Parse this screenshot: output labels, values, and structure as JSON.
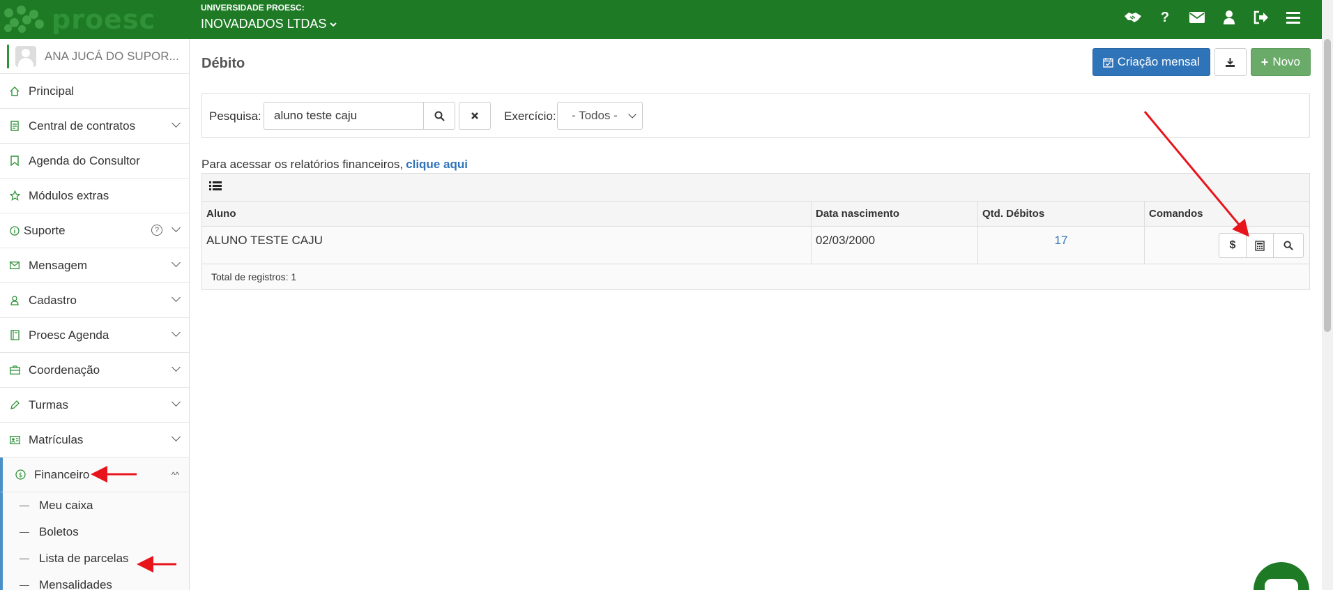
{
  "header": {
    "org_small": "UNIVERSIDADE PROESC:",
    "org_name": "INOVADADOS LTDAS",
    "logo_text": "proesc",
    "icons": [
      "handshake-icon",
      "question-icon",
      "envelope-icon",
      "user-icon",
      "sign-out-icon",
      "menu-icon"
    ]
  },
  "sidebar": {
    "user_name": "ANA JUCÁ DO SUPOR...",
    "items": [
      {
        "label": "Principal",
        "icon": "home-icon"
      },
      {
        "label": "Central de contratos",
        "icon": "document-icon"
      },
      {
        "label": "Agenda do Consultor",
        "icon": "bookmark-icon"
      },
      {
        "label": "Módulos extras",
        "icon": "star-icon"
      },
      {
        "label": "Suporte",
        "icon": "info-icon"
      },
      {
        "label": "Mensagem",
        "icon": "envelope-icon"
      },
      {
        "label": "Cadastro",
        "icon": "user-icon"
      },
      {
        "label": "Proesc Agenda",
        "icon": "book-icon"
      },
      {
        "label": "Coordenação",
        "icon": "briefcase-icon"
      },
      {
        "label": "Turmas",
        "icon": "pencil-icon"
      },
      {
        "label": "Matrículas",
        "icon": "id-card-icon"
      },
      {
        "label": "Financeiro",
        "icon": "dollar-circle-icon"
      }
    ],
    "financeiro_sub": [
      {
        "label": "Meu caixa"
      },
      {
        "label": "Boletos"
      },
      {
        "label": "Lista de parcelas"
      },
      {
        "label": "Mensalidades"
      }
    ]
  },
  "main": {
    "title": "Débito",
    "actions": {
      "criacao_mensal": "Criação mensal",
      "novo": "Novo"
    },
    "filter": {
      "search_label": "Pesquisa:",
      "search_value": "aluno teste caju",
      "exercicio_label": "Exercício:",
      "exercicio_value": "- Todos -"
    },
    "report_text": "Para acessar os relatórios financeiros,",
    "report_link": "clique aqui",
    "table": {
      "columns": [
        "Aluno",
        "Data nascimento",
        "Qtd. Débitos",
        "Comandos"
      ],
      "rows": [
        {
          "aluno": "ALUNO TESTE CAJU",
          "data_nascimento": "02/03/2000",
          "qtd_debitos": "17"
        }
      ],
      "total": "Total de registros: 1"
    }
  },
  "colors": {
    "header_green": "#1f7a26",
    "primary_blue": "#2f73b8",
    "success_green": "#6aab6a",
    "annotation_red": "#e8141c"
  }
}
